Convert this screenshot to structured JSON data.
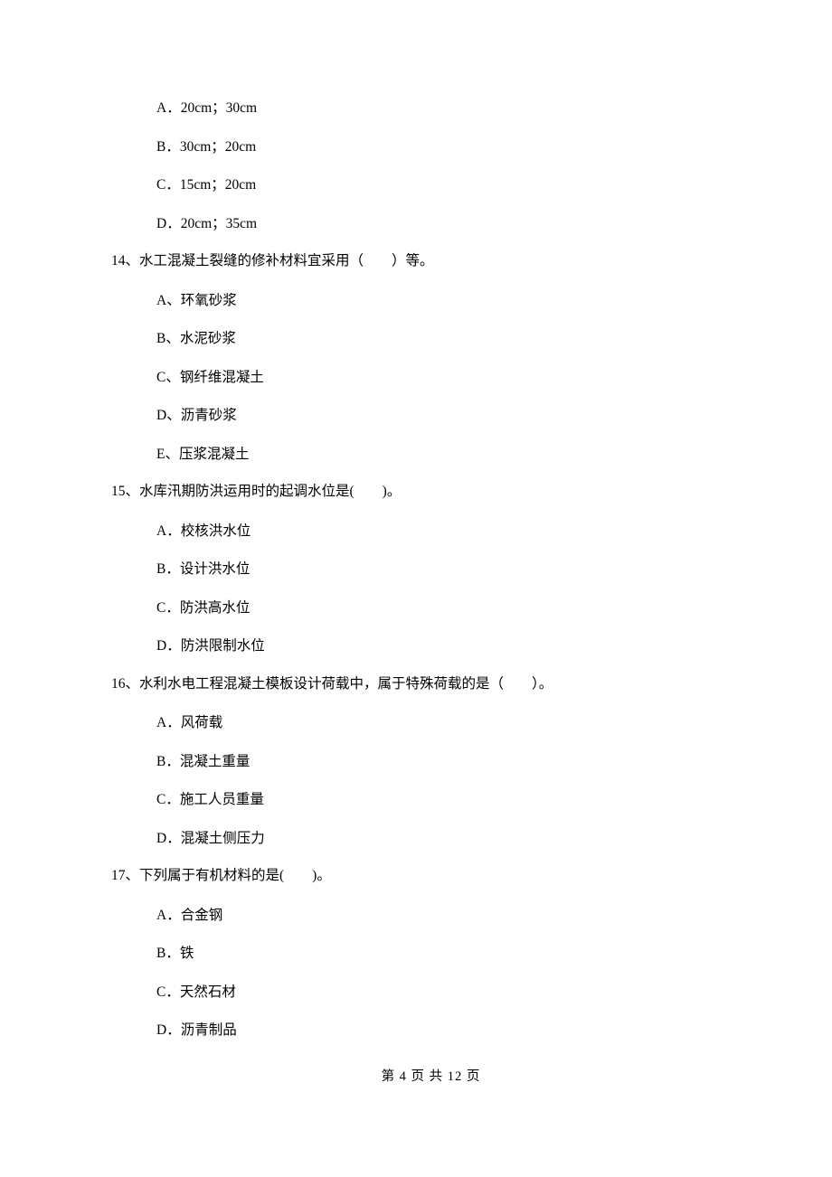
{
  "pre_options": {
    "a": "A．20cm；30cm",
    "b": "B．30cm；20cm",
    "c": "C．15cm；20cm",
    "d": "D．20cm；35cm"
  },
  "q14": {
    "text": "14、水工混凝土裂缝的修补材料宜采用（　　）等。",
    "a": "A、环氧砂浆",
    "b": "B、水泥砂浆",
    "c": "C、钢纤维混凝土",
    "d": "D、沥青砂浆",
    "e": "E、压浆混凝土"
  },
  "q15": {
    "text": "15、水库汛期防洪运用时的起调水位是(　　)。",
    "a": "A．校核洪水位",
    "b": "B．设计洪水位",
    "c": "C．防洪高水位",
    "d": "D．防洪限制水位"
  },
  "q16": {
    "text": "16、水利水电工程混凝土模板设计荷载中，属于特殊荷载的是（　　）。",
    "a": "A．风荷载",
    "b": "B．混凝土重量",
    "c": "C．施工人员重量",
    "d": "D．混凝土侧压力"
  },
  "q17": {
    "text": "17、下列属于有机材料的是(　　)。",
    "a": "A．合金钢",
    "b": "B．铁",
    "c": "C．天然石材",
    "d": "D．沥青制品"
  },
  "footer": "第 4 页 共 12 页"
}
